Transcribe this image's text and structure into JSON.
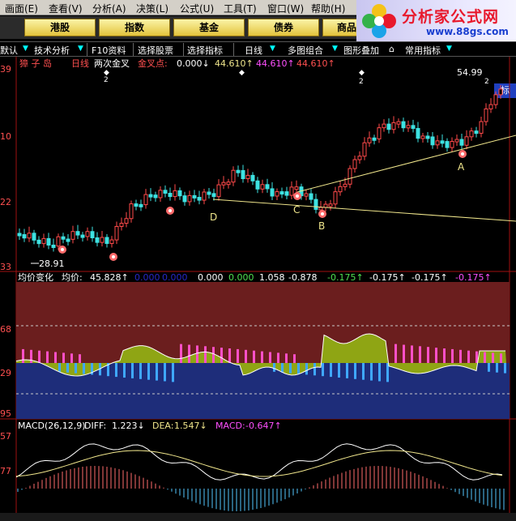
{
  "menu": [
    "画面(E)",
    "查看(V)",
    "分析(A)",
    "决策(L)",
    "公式(U)",
    "工具(T)",
    "窗口(W)",
    "帮助(H)"
  ],
  "logo": {
    "title": "分析家公式网",
    "url": "www.88gs.com"
  },
  "quick_buttons": [
    "港股",
    "指数",
    "基金",
    "债券",
    "商品"
  ],
  "toolbar": {
    "left_cut": "默认",
    "items": [
      "技术分析",
      "F10资料",
      "选择股票",
      "选择指标",
      "日线",
      "多图组合",
      "图形叠加",
      "常用指标"
    ],
    "side": "标"
  },
  "price_panel": {
    "stock_name": "獐 子 岛",
    "period": "日线",
    "indicator": "两次金叉",
    "golden_cross_label": "金叉点:",
    "values": [
      "0.000↓",
      "44.610↑",
      "44.610↑",
      "44.610↑"
    ],
    "y_ticks": [
      "39",
      "10",
      "22",
      "33"
    ],
    "high_label": "54.99",
    "low_label": "28.91",
    "points": [
      "A",
      "B",
      "C",
      "D"
    ],
    "marker_numbers": [
      "2",
      "2",
      "2"
    ]
  },
  "avg_panel": {
    "title": "均价变化",
    "avg_label": "均价:",
    "avg_value": "45.828↑",
    "values": [
      "0.000",
      "0.000",
      "0.000",
      "0.000",
      "1.058",
      "-0.878",
      "-0.175↑",
      "-0.175↑",
      "-0.175↑",
      "-0.175↑"
    ],
    "y_ticks": [
      "68",
      "29",
      "95"
    ]
  },
  "macd_panel": {
    "title": "MACD(26,12,9)",
    "diff_label": "DIFF:",
    "diff_value": "1.223↓",
    "dea_label": "DEA:",
    "dea_value": "1.547↓",
    "macd_label": "MACD:",
    "macd_value": "-0.647↑",
    "y_ticks": [
      "57",
      "77"
    ]
  },
  "colors": {
    "up": "#ff4a4a",
    "down": "#3de2e2",
    "upper_band": "#6b1e1e",
    "lower_band": "#1e2d7a",
    "avg_fill": "#8fa514",
    "yellow": "#f0e68c",
    "macd_up": "#ff6b6b",
    "macd_down": "#54c8ff",
    "marker": "#ff6b6b",
    "magenta": "#ff50ff"
  }
}
